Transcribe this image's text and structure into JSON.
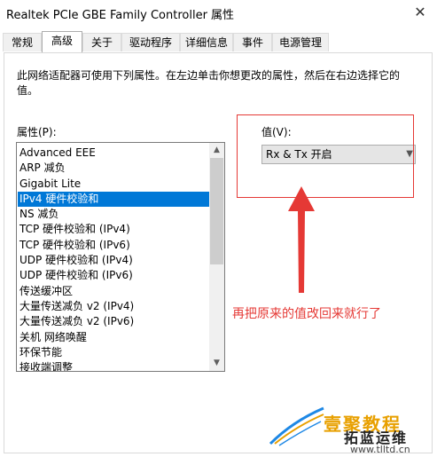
{
  "window": {
    "title": "Realtek PCIe GBE Family Controller 属性",
    "close_glyph": "✕"
  },
  "tabs": [
    {
      "label": "常规"
    },
    {
      "label": "高级"
    },
    {
      "label": "关于"
    },
    {
      "label": "驱动程序"
    },
    {
      "label": "详细信息"
    },
    {
      "label": "事件"
    },
    {
      "label": "电源管理"
    }
  ],
  "active_tab": "高级",
  "description": "此网络适配器可使用下列属性。在左边单击你想更改的属性，然后在右边选择它的值。",
  "properties": {
    "label": "属性(P):",
    "items": [
      "Advanced EEE",
      "ARP 减负",
      "Gigabit Lite",
      "IPv4 硬件校验和",
      "NS 减负",
      "TCP 硬件校验和 (IPv4)",
      "TCP 硬件校验和 (IPv6)",
      "UDP 硬件校验和 (IPv4)",
      "UDP 硬件校验和 (IPv6)",
      "传送缓冲区",
      "大量传送减负 v2 (IPv4)",
      "大量传送减负 v2 (IPv6)",
      "关机 网络唤醒",
      "环保节能",
      "接收端调整"
    ],
    "selected": "IPv4 硬件校验和"
  },
  "value": {
    "label": "值(V):",
    "selected": "Rx & Tx 开启"
  },
  "annotation": "再把原来的值改回来就行了",
  "watermark": {
    "line1": "壹聚教程",
    "line2": "拓蓝运维",
    "line3": "www.tlltd.cn"
  },
  "colors": {
    "selection": "#0078d7",
    "annotation": "#e53935"
  },
  "icons": {
    "close": "close-icon",
    "scroll_up": "chevron-up-icon",
    "scroll_down": "chevron-down-icon",
    "dropdown": "chevron-down-icon"
  }
}
